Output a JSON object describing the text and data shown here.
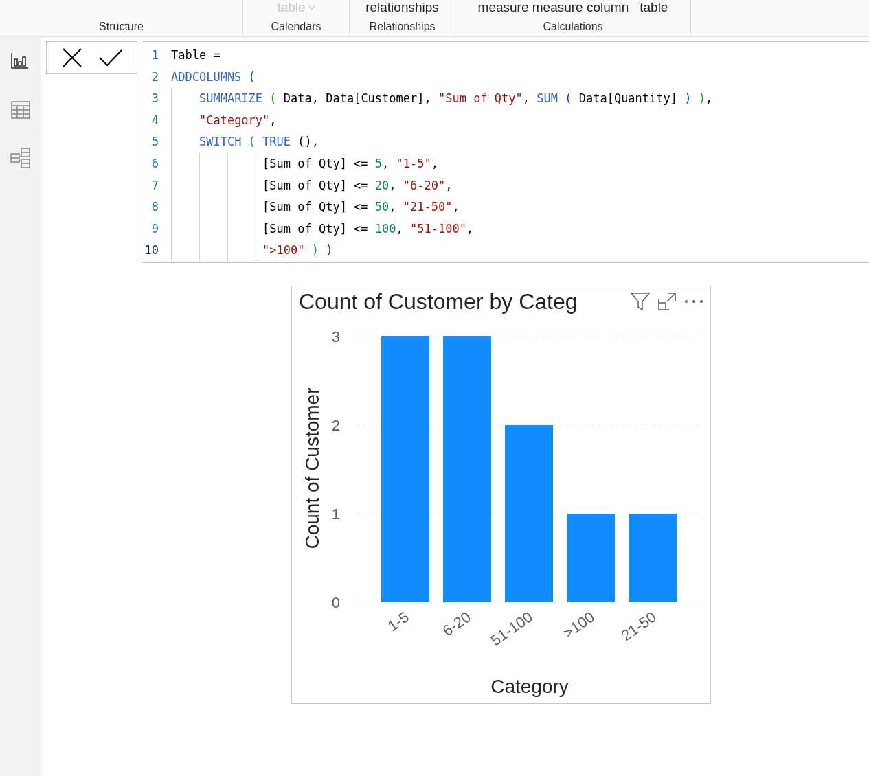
{
  "ribbon": {
    "groups": [
      {
        "label": "Structure"
      },
      {
        "items": [
          {
            "text": "table",
            "disabled": true,
            "dropdown": true
          }
        ],
        "label": "Calendars"
      },
      {
        "items": [
          {
            "text": "relationships",
            "disabled": false,
            "dropdown": false
          }
        ],
        "label": "Relationships"
      },
      {
        "items": [
          {
            "text": "measure measure column",
            "disabled": false,
            "dropdown": false
          },
          {
            "text": "table",
            "disabled": false,
            "dropdown": false
          }
        ],
        "label": "Calculations"
      }
    ]
  },
  "sidebar": {
    "items": [
      {
        "kind": "report",
        "selected": true
      },
      {
        "kind": "data",
        "selected": false
      },
      {
        "kind": "model",
        "selected": false
      }
    ]
  },
  "formula_bar": {
    "lines": [
      {
        "number": "1",
        "tokens": [
          {
            "kind": "plain",
            "text": "Table ="
          }
        ]
      },
      {
        "number": "2",
        "tokens": [
          {
            "kind": "keyword",
            "text": "ADDCOLUMNS"
          },
          {
            "kind": "paren",
            "text": " ("
          }
        ]
      },
      {
        "number": "3",
        "tokens": [
          {
            "kind": "keyword",
            "text": "    SUMMARIZE"
          },
          {
            "kind": "paren2",
            "text": " ("
          },
          {
            "kind": "plain",
            "text": " Data, Data[Customer], "
          },
          {
            "kind": "string",
            "text": "\"Sum of Qty\""
          },
          {
            "kind": "plain",
            "text": ", "
          },
          {
            "kind": "keyword",
            "text": "SUM"
          },
          {
            "kind": "paren",
            "text": " ("
          },
          {
            "kind": "plain",
            "text": " Data[Quantity] "
          },
          {
            "kind": "paren",
            "text": ")"
          },
          {
            "kind": "paren2",
            "text": " )"
          },
          {
            "kind": "plain",
            "text": ","
          }
        ]
      },
      {
        "number": "4",
        "tokens": [
          {
            "kind": "string",
            "text": "    \"Category\""
          },
          {
            "kind": "plain",
            "text": ","
          }
        ]
      },
      {
        "number": "5",
        "tokens": [
          {
            "kind": "keyword",
            "text": "    SWITCH"
          },
          {
            "kind": "paren2",
            "text": " ("
          },
          {
            "kind": "keyword",
            "text": " TRUE"
          },
          {
            "kind": "plain",
            "text": " (),"
          }
        ]
      },
      {
        "number": "6",
        "tokens": [
          {
            "kind": "plain",
            "text": "             [Sum of Qty] <= "
          },
          {
            "kind": "number",
            "text": "5"
          },
          {
            "kind": "plain",
            "text": ", "
          },
          {
            "kind": "string",
            "text": "\"1-5\""
          },
          {
            "kind": "plain",
            "text": ","
          }
        ]
      },
      {
        "number": "7",
        "tokens": [
          {
            "kind": "plain",
            "text": "             [Sum of Qty] <= "
          },
          {
            "kind": "number",
            "text": "20"
          },
          {
            "kind": "plain",
            "text": ", "
          },
          {
            "kind": "string",
            "text": "\"6-20\""
          },
          {
            "kind": "plain",
            "text": ","
          }
        ]
      },
      {
        "number": "8",
        "tokens": [
          {
            "kind": "plain",
            "text": "             [Sum of Qty] <= "
          },
          {
            "kind": "number",
            "text": "50"
          },
          {
            "kind": "plain",
            "text": ", "
          },
          {
            "kind": "string",
            "text": "\"21-50\""
          },
          {
            "kind": "plain",
            "text": ","
          }
        ]
      },
      {
        "number": "9",
        "tokens": [
          {
            "kind": "plain",
            "text": "             [Sum of Qty] <= "
          },
          {
            "kind": "number",
            "text": "100"
          },
          {
            "kind": "plain",
            "text": ", "
          },
          {
            "kind": "string",
            "text": "\"51-100\""
          },
          {
            "kind": "plain",
            "text": ","
          }
        ]
      },
      {
        "number": "10",
        "tokens": [
          {
            "kind": "string",
            "text": "             \">100\""
          },
          {
            "kind": "paren2",
            "text": " )"
          },
          {
            "kind": "paren",
            "text": " )"
          }
        ]
      }
    ]
  },
  "visual": {
    "title": "Count of Customer by Categ",
    "chart_data": {
      "type": "bar",
      "xlabel": "Category",
      "ylabel": "Count of Customer",
      "categories": [
        "1-5",
        "6-20",
        "51-100",
        ">100",
        "21-50"
      ],
      "series": [
        {
          "color": "#118dff",
          "values": [
            3,
            3,
            2,
            1,
            1
          ]
        }
      ],
      "ylim": [
        0,
        3
      ],
      "yticks": [
        0,
        1,
        2,
        3
      ]
    }
  }
}
